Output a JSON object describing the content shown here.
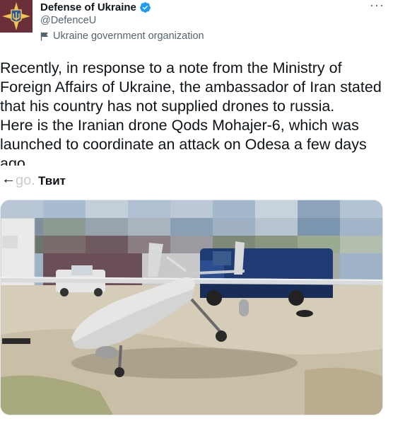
{
  "account": {
    "display_name": "Defense of Ukraine",
    "handle": "@DefenceU",
    "label": "Ukraine government organization",
    "verified_icon": "verified-badge-icon",
    "avatar_icon": "ukraine-coat-of-arms-icon"
  },
  "tweet": {
    "paragraph1": "Recently, in response to a note from the Ministry of Foreign Affairs of Ukraine, the ambassador of Iran stated that his country has not supplied drones to russia.",
    "paragraph2": "Here is the Iranian drone Qods Mohajer-6, which was launched to coordinate an attack on Odesa a few days ago."
  },
  "nav": {
    "back_glyph": "←",
    "ghost_text": "go.",
    "title": "Твит"
  },
  "media": {
    "alt": "Iranian drone Qods Mohajer-6 parked outdoors next to vehicles"
  },
  "colors": {
    "verified": "#1d9bf0",
    "secondary_text": "#536471",
    "primary_text": "#0f1419"
  }
}
